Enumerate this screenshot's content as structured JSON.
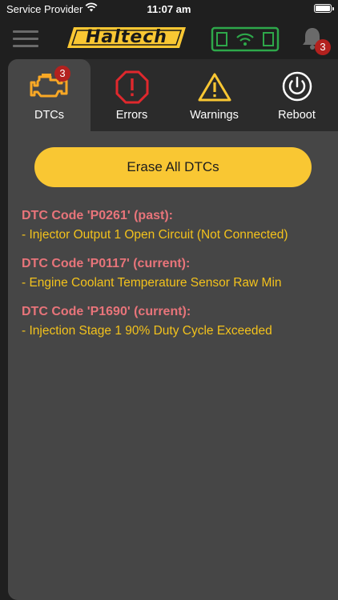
{
  "status_bar": {
    "carrier": "Service Provider",
    "time": "11:07 am"
  },
  "header": {
    "logo_text": "Haltech",
    "notification_count": "3"
  },
  "tabs": [
    {
      "label": "DTCs",
      "icon": "engine-icon",
      "badge": "3",
      "active": true
    },
    {
      "label": "Errors",
      "icon": "error-octagon-icon",
      "badge": null,
      "active": false
    },
    {
      "label": "Warnings",
      "icon": "warning-triangle-icon",
      "badge": null,
      "active": false
    },
    {
      "label": "Reboot",
      "icon": "power-icon",
      "badge": null,
      "active": false
    }
  ],
  "erase_button_label": "Erase All DTCs",
  "dtcs": [
    {
      "code": "DTC Code 'P0261' (past):",
      "description": "- Injector Output 1 Open Circuit (Not Connected)"
    },
    {
      "code": "DTC Code 'P0117' (current):",
      "description": "- Engine Coolant Temperature Sensor Raw Min"
    },
    {
      "code": "DTC Code 'P1690' (current):",
      "description": "- Injection Stage 1 90% Duty Cycle Exceeded"
    }
  ],
  "colors": {
    "accent_yellow": "#f9c733",
    "dtc_code": "#e8747a",
    "dtc_description": "#f3c21c",
    "error_red": "#e0282d",
    "ecu_green": "#2ea84a"
  }
}
